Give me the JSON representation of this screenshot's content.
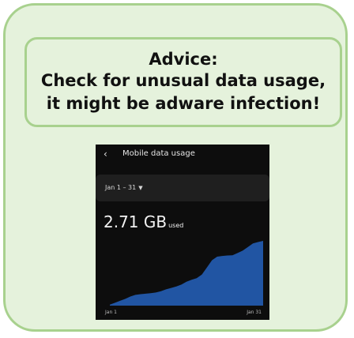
{
  "advice": {
    "title": "Advice:",
    "line1": "Check for unusual data usage,",
    "line2": "it might be adware infection!"
  },
  "phone": {
    "header_title": "Mobile data usage",
    "range_label": "Jan 1 – 31",
    "usage_value": "2.71 GB",
    "usage_unit": "used"
  },
  "chart_data": {
    "type": "area",
    "x": [
      1,
      2,
      3,
      4,
      5,
      6,
      7,
      8,
      9,
      10,
      11,
      12,
      13,
      14,
      15,
      16,
      17,
      18,
      19,
      20,
      21,
      22,
      23,
      24,
      25,
      26,
      27,
      28,
      29,
      30,
      31
    ],
    "values": [
      0.04,
      0.12,
      0.2,
      0.28,
      0.38,
      0.45,
      0.48,
      0.5,
      0.52,
      0.55,
      0.6,
      0.68,
      0.74,
      0.8,
      0.88,
      1.0,
      1.08,
      1.15,
      1.3,
      1.6,
      1.9,
      2.05,
      2.08,
      2.1,
      2.11,
      2.2,
      2.3,
      2.45,
      2.6,
      2.66,
      2.71
    ],
    "x_tick_labels": [
      "Jan 1",
      "Jan 31"
    ],
    "ylim": [
      0,
      2.71
    ],
    "color": "#2155a3"
  }
}
